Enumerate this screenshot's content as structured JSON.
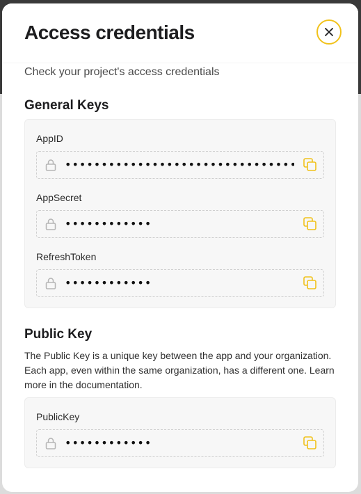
{
  "modal": {
    "title": "Access credentials",
    "subtitle": "Check your project's access credentials",
    "close_icon": "close-icon"
  },
  "general_keys": {
    "title": "General Keys",
    "fields": [
      {
        "label": "AppID",
        "value": "••••••••••••••••••••••••••••••••••••••••"
      },
      {
        "label": "AppSecret",
        "value": "••••••••••••"
      },
      {
        "label": "RefreshToken",
        "value": "••••••••••••"
      }
    ]
  },
  "public_key": {
    "title": "Public Key",
    "description": "The Public Key is a unique key between the app and your organization. Each app, even within the same organization, has a different one. Learn more in the documentation.",
    "fields": [
      {
        "label": "PublicKey",
        "value": "••••••••••••"
      }
    ]
  },
  "icons": {
    "field_lock": "lock-icon",
    "field_copy": "copy-icon"
  },
  "colors": {
    "accent": "#f1c21b",
    "title_text": "#1d1d1f"
  }
}
